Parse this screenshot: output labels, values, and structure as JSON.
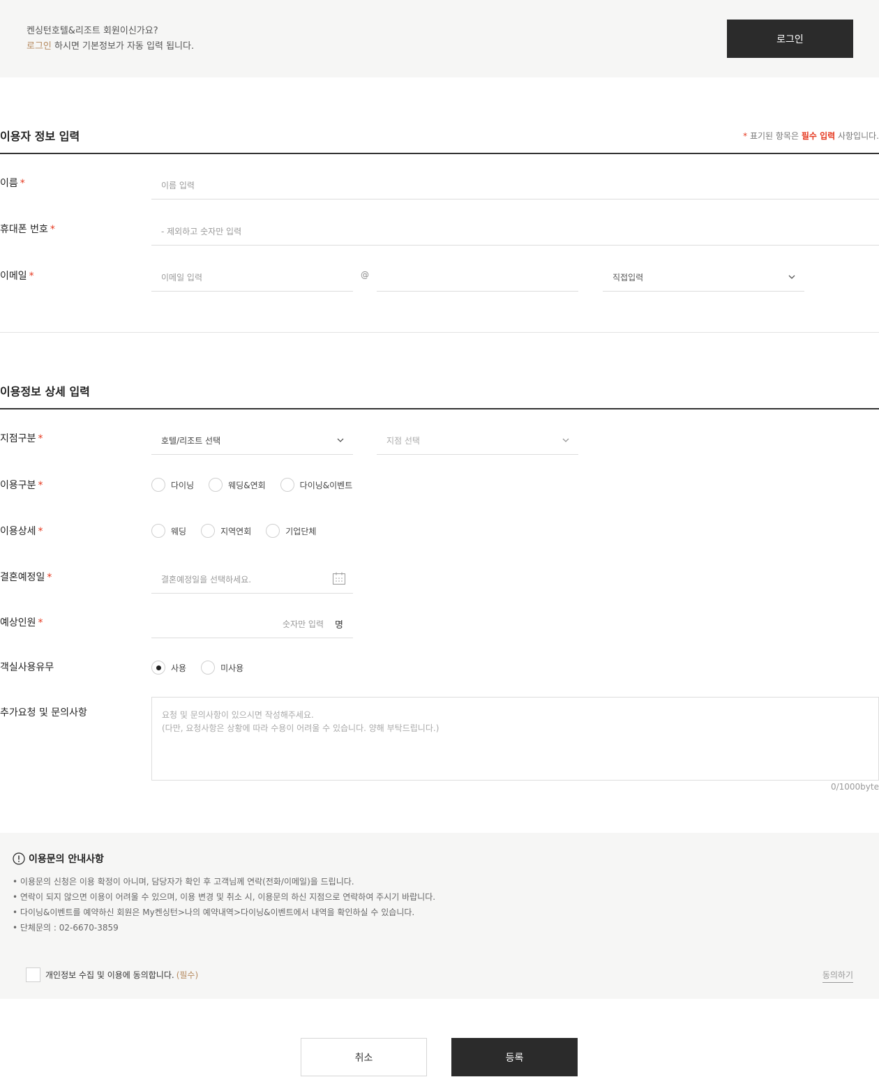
{
  "login_banner": {
    "line1": "켄싱턴호텔&리조트 회원이신가요?",
    "line2_link": "로그인",
    "line2_rest": " 하시면 기본정보가 자동 입력 됩니다.",
    "button": "로그인"
  },
  "user_info": {
    "title": "이용자 정보 입력",
    "required_note": {
      "star": "*",
      "pre": " 표기된 항목은 ",
      "emph": "필수 입력",
      "post": " 사항입니다."
    },
    "name": {
      "label": "이름",
      "placeholder": "이름 입력"
    },
    "phone": {
      "label": "휴대폰 번호",
      "placeholder": "- 제외하고 숫자만 입력"
    },
    "email": {
      "label": "이메일",
      "id_placeholder": "이메일 입력",
      "at": "@",
      "domain_value": "",
      "domain_select": "직접입력"
    }
  },
  "detail_info": {
    "title": "이용정보 상세 입력",
    "branch": {
      "label": "지점구분",
      "hotel_select": "호텔/리조트 선택",
      "branch_select": "지점 선택"
    },
    "usage_type": {
      "label": "이용구분",
      "options": [
        "다이닝",
        "웨딩&연회",
        "다이닝&이벤트"
      ]
    },
    "usage_detail": {
      "label": "이용상세",
      "options": [
        "웨딩",
        "지역연회",
        "기업단체"
      ]
    },
    "wedding_date": {
      "label": "결혼예정일",
      "placeholder": "결혼예정일을 선택하세요."
    },
    "guests": {
      "label": "예상인원",
      "placeholder": "숫자만 입력",
      "unit": "명"
    },
    "room_use": {
      "label": "객실사용유무",
      "options": [
        "사용",
        "미사용"
      ],
      "selected": "사용"
    },
    "requests": {
      "label": "추가요청 및 문의사항",
      "placeholder_line1": "요청 및 문의사항이 있으시면 작성해주세요.",
      "placeholder_line2": "(다만, 요청사항은 상황에 따라 수용이 어려울 수 있습니다. 양해 부탁드립니다.)",
      "byte_count": "0/1000byte"
    },
    "required_star": "*"
  },
  "notice": {
    "title": "이용문의 안내사항",
    "items": [
      "이용문의 신청은 이용 확정이 아니며, 담당자가 확인 후 고객님께 연락(전화/이메일)을 드립니다.",
      "연락이 되지 않으면 이용이 어려울 수 있으며, 이용 변경 및 취소 시, 이용문의 하신 지점으로 연락하여 주시기 바랍니다.",
      "다이닝&이벤트를 예약하신 회원은 My켄싱턴>나의 예약내역>다이닝&이벤트에서 내역을 확인하실 수 있습니다.",
      "단체문의 : 02-6670-3859"
    ],
    "agree_text": "개인정보 수집 및 이용에 동의합니다.",
    "agree_required": "(필수)",
    "agree_link": "동의하기"
  },
  "actions": {
    "cancel": "취소",
    "submit": "등록"
  },
  "colors": {
    "accent_red": "#e5381f",
    "accent_tan": "#b58a5f",
    "dark_button": "#2b2b2b",
    "banner_bg": "#f6f6f5"
  }
}
